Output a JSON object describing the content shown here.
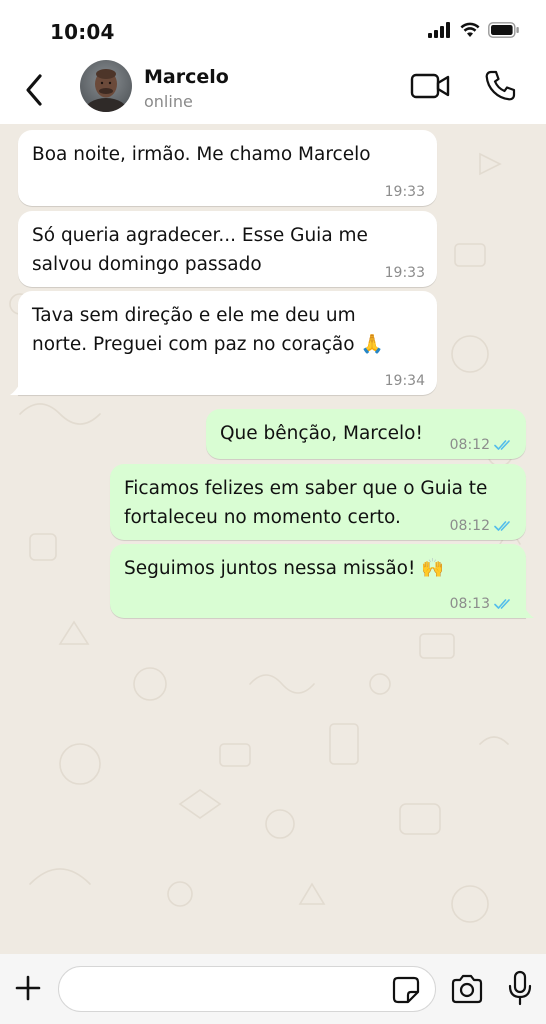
{
  "status_bar": {
    "time": "10:04"
  },
  "header": {
    "contact_name": "Marcelo",
    "contact_status": "online"
  },
  "messages": [
    {
      "direction": "in",
      "text": "Boa noite, irmão. Me chamo Marcelo",
      "time": "19:33"
    },
    {
      "direction": "in",
      "text": "Só queria agradecer... Esse Guia me\nsalvou domingo passado",
      "time": "19:33"
    },
    {
      "direction": "in",
      "text": "Tava sem direção e ele me deu um\nnorte. Preguei com paz no coração 🙏",
      "time": "19:34"
    },
    {
      "direction": "out",
      "text": "Que bênção, Marcelo!",
      "time": "08:12",
      "status": "read"
    },
    {
      "direction": "out",
      "text": "Ficamos felizes em saber que o Guia te\nfortaleceu no momento certo.",
      "time": "08:12",
      "status": "read"
    },
    {
      "direction": "out",
      "text": "Seguimos juntos nessa missão! 🙌",
      "time": "08:13",
      "status": "read"
    }
  ],
  "composer": {
    "value": "",
    "placeholder": ""
  },
  "icons": {
    "back": "chevron-left-icon",
    "video": "video-camera-icon",
    "call": "phone-icon",
    "plus": "plus-icon",
    "sticker": "sticker-icon",
    "camera": "camera-icon",
    "mic": "microphone-icon",
    "read_ticks": "double-check-icon"
  },
  "colors": {
    "chat_background": "#efeae2",
    "incoming_bubble": "#ffffff",
    "outgoing_bubble": "#d9fdd3",
    "read_tick": "#53bdeb"
  }
}
